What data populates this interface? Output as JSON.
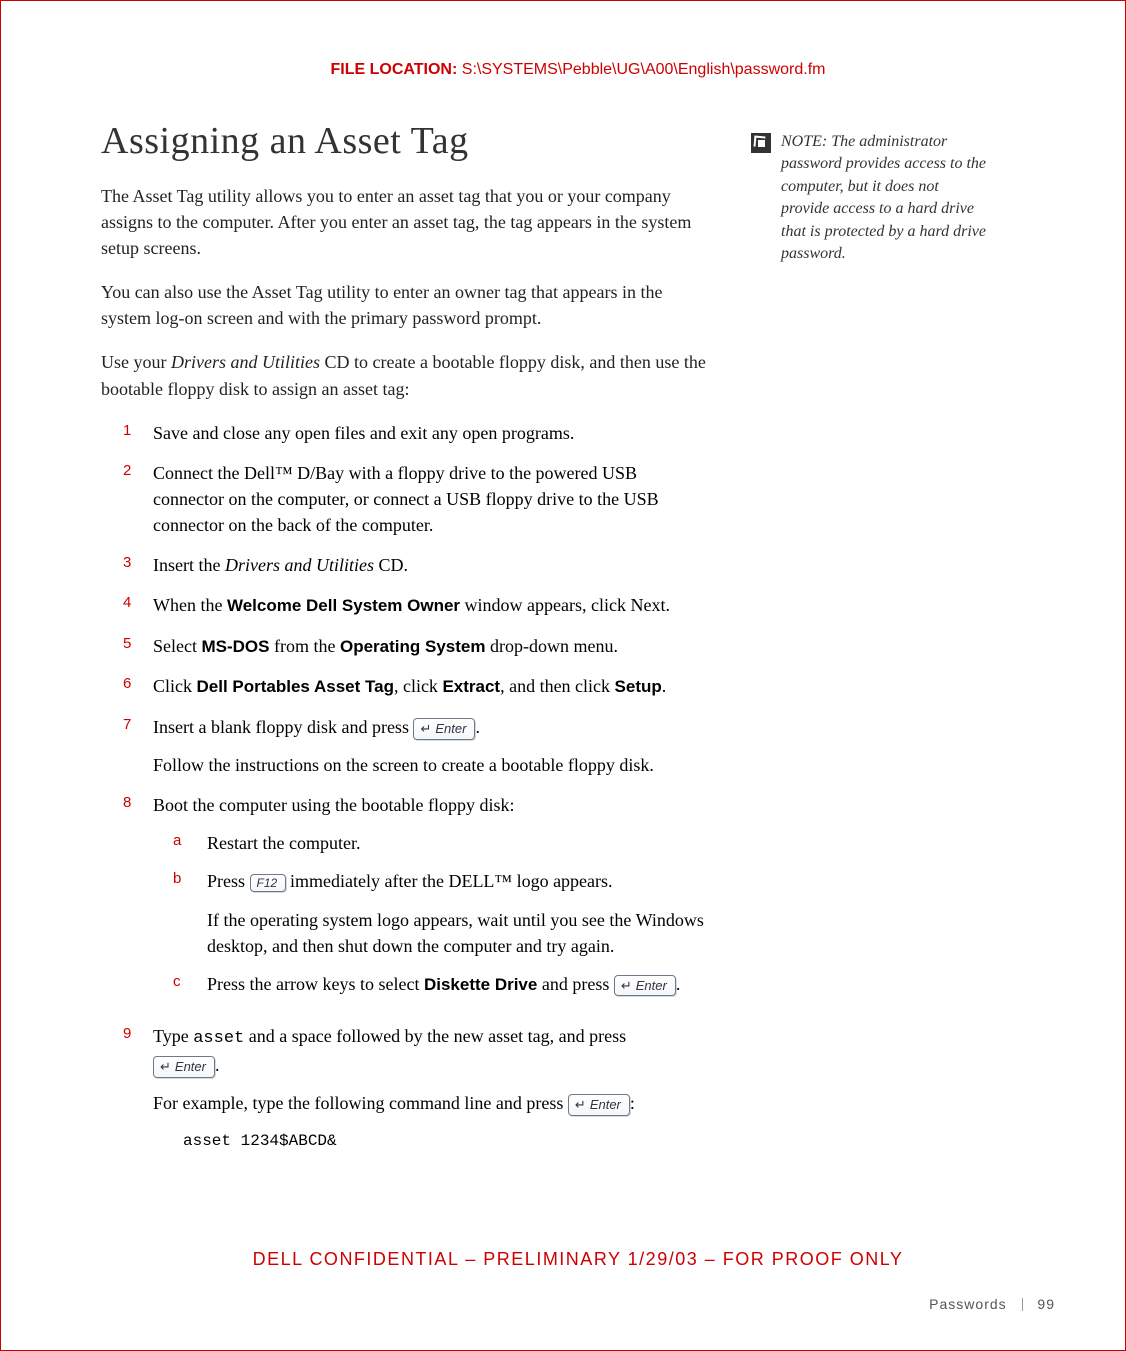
{
  "file_location": {
    "label": "FILE LOCATION:",
    "path": "S:\\SYSTEMS\\Pebble\\UG\\A00\\English\\password.fm"
  },
  "title": "Assigning an Asset Tag",
  "intro": {
    "p1": "The Asset Tag utility allows you to enter an asset tag that you or your company assigns to the computer. After you enter an asset tag, the tag appears in the system setup screens.",
    "p2": "You can also use the Asset Tag utility to enter an owner tag that appears in the system log-on screen and with the primary password prompt.",
    "p3a": "Use your ",
    "p3b": "Drivers and Utilities",
    "p3c": " CD to create a bootable floppy disk, and then use the bootable floppy disk to assign an asset tag:"
  },
  "steps": {
    "n1": "1",
    "s1": "Save and close any open files and exit any open programs.",
    "n2": "2",
    "s2": "Connect the Dell™ D/Bay with a floppy drive to the powered USB connector on the computer, or connect a USB floppy drive to the USB connector on the back of the computer.",
    "n3": "3",
    "s3a": "Insert the ",
    "s3b": "Drivers and Utilities",
    "s3c": " CD.",
    "n4": "4",
    "s4a": "When the ",
    "s4b": "Welcome Dell System Owner",
    "s4c": " window appears, click Next.",
    "n5": "5",
    "s5a": "Select ",
    "s5b": "MS-DOS",
    "s5c": " from the ",
    "s5d": "Operating System",
    "s5e": " drop-down menu.",
    "n6": "6",
    "s6a": "Click ",
    "s6b": "Dell Portables Asset Tag",
    "s6c": ", click ",
    "s6d": "Extract",
    "s6e": ", and then click ",
    "s6f": "Setup",
    "s6g": ".",
    "n7": "7",
    "s7a": "Insert a blank floppy disk and press ",
    "s7b": ".",
    "s7f": "Follow the instructions on the screen to create a bootable floppy disk.",
    "n8": "8",
    "s8": "Boot the computer using the bootable floppy disk:",
    "na": "a",
    "sa": "Restart the computer.",
    "nb": "b",
    "sba": "Press ",
    "sbb": " immediately after the DELL™ logo appears.",
    "sbf": "If the operating system logo appears, wait until you see the Windows desktop, and then shut down the computer and try again.",
    "nc": "c",
    "sca": "Press the arrow keys to select ",
    "scb": "Diskette Drive",
    "scc": " and press ",
    "scd": ".",
    "n9": "9",
    "s9a": "Type ",
    "s9b": "asset",
    "s9c": " and a space followed by the new asset tag, and press ",
    "s9d": ".",
    "s9e": "For example, type the following command line and press ",
    "s9f": ":",
    "s9code": "asset 1234$ABCD&"
  },
  "keys": {
    "enter": "Enter",
    "f12": "F12"
  },
  "note": {
    "label": "NOTE: ",
    "text": "The administrator password provides access to the computer, but it does not provide access to a hard drive that is protected by a hard drive password."
  },
  "confidential": "DELL CONFIDENTIAL – PRELIMINARY 1/29/03 – FOR PROOF ONLY",
  "footer": {
    "section": "Passwords",
    "page": "99"
  }
}
